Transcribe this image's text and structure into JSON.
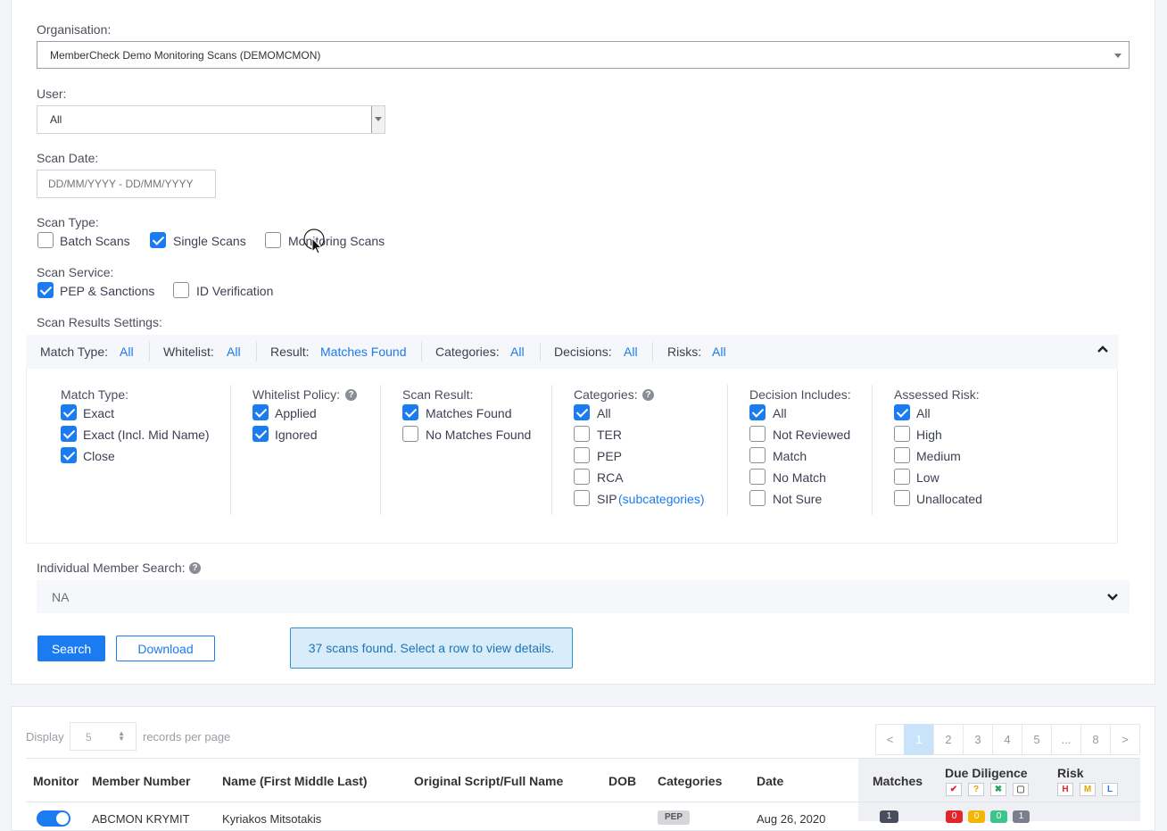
{
  "form": {
    "organisation_label": "Organisation:",
    "organisation_value": "MemberCheck Demo Monitoring Scans (DEMOMCMON)",
    "user_label": "User:",
    "user_value": "All",
    "scan_date_label": "Scan Date:",
    "scan_date_placeholder": "DD/MM/YYYY - DD/MM/YYYY",
    "scan_type_label": "Scan Type:",
    "scan_types": [
      {
        "label": "Batch Scans",
        "checked": false
      },
      {
        "label": "Single Scans",
        "checked": true
      },
      {
        "label": "Monitoring Scans",
        "checked": false
      }
    ],
    "scan_service_label": "Scan Service:",
    "scan_services": [
      {
        "label": "PEP & Sanctions",
        "checked": true
      },
      {
        "label": "ID Verification",
        "checked": false
      }
    ],
    "scan_results_settings_label": "Scan Results Settings:"
  },
  "summary": {
    "match_type_label": "Match Type:",
    "match_type_value": "All",
    "whitelist_label": "Whitelist:",
    "whitelist_value": "All",
    "result_label": "Result:",
    "result_value": "Matches Found",
    "categories_label": "Categories:",
    "categories_value": "All",
    "decisions_label": "Decisions:",
    "decisions_value": "All",
    "risks_label": "Risks:",
    "risks_value": "All"
  },
  "settings": {
    "match_type": {
      "title": "Match Type:",
      "options": [
        {
          "label": "Exact",
          "checked": true
        },
        {
          "label": "Exact (Incl. Mid Name)",
          "checked": true
        },
        {
          "label": "Close",
          "checked": true
        }
      ]
    },
    "whitelist_policy": {
      "title": "Whitelist Policy:",
      "options": [
        {
          "label": "Applied",
          "checked": true
        },
        {
          "label": "Ignored",
          "checked": true
        }
      ]
    },
    "scan_result": {
      "title": "Scan Result:",
      "options": [
        {
          "label": "Matches Found",
          "checked": true
        },
        {
          "label": "No Matches Found",
          "checked": false
        }
      ]
    },
    "categories": {
      "title": "Categories:",
      "options": [
        {
          "label": "All",
          "checked": true
        },
        {
          "label": "TER",
          "checked": false
        },
        {
          "label": "PEP",
          "checked": false
        },
        {
          "label": "RCA",
          "checked": false
        },
        {
          "label": "SIP",
          "checked": false
        }
      ],
      "sip_link": "(subcategories)"
    },
    "decision_includes": {
      "title": "Decision Includes:",
      "options": [
        {
          "label": "All",
          "checked": true
        },
        {
          "label": "Not Reviewed",
          "checked": false
        },
        {
          "label": "Match",
          "checked": false
        },
        {
          "label": "No Match",
          "checked": false
        },
        {
          "label": "Not Sure",
          "checked": false
        }
      ]
    },
    "assessed_risk": {
      "title": "Assessed Risk:",
      "options": [
        {
          "label": "All",
          "checked": true
        },
        {
          "label": "High",
          "checked": false
        },
        {
          "label": "Medium",
          "checked": false
        },
        {
          "label": "Low",
          "checked": false
        },
        {
          "label": "Unallocated",
          "checked": false
        }
      ]
    }
  },
  "member_search": {
    "label": "Individual Member Search:",
    "value": "NA"
  },
  "actions": {
    "search_label": "Search",
    "download_label": "Download",
    "info_message": "37 scans found. Select a row to view details."
  },
  "table": {
    "display_label": "Display",
    "per_page_value": "5",
    "records_per_page": "records per page",
    "pagination": [
      "<",
      "1",
      "2",
      "3",
      "4",
      "5",
      "...",
      "8",
      ">"
    ],
    "headers": {
      "monitor": "Monitor",
      "member_number": "Member Number",
      "name": "Name (First Middle Last)",
      "original_script": "Original Script/Full Name",
      "dob": "DOB",
      "categories": "Categories",
      "date": "Date",
      "matches": "Matches",
      "due_diligence": "Due Diligence",
      "risk": "Risk"
    },
    "dd_icons": [
      "✔",
      "?",
      "✖",
      "▢"
    ],
    "risk_icons": [
      "H",
      "M",
      "L"
    ],
    "first_row": {
      "member_number": "ABCMON KRYMIT",
      "name": "Kyriakos Mitsotakis",
      "category": "PEP",
      "date": "Aug 26, 2020",
      "matches": "1",
      "dd_counts": [
        "0",
        "0",
        "0",
        "1"
      ]
    }
  },
  "colors": {
    "accent": "#1b7bf0",
    "info_bg": "#d8ecf9",
    "info_border": "#2a93d8"
  }
}
